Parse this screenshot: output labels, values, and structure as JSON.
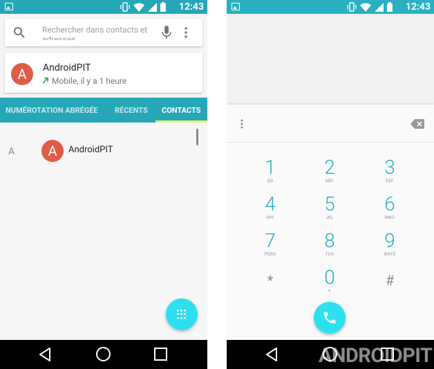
{
  "status_bar": {
    "time": "12:43",
    "icons": [
      "vibrate-icon",
      "wifi-icon",
      "signal-icon",
      "battery-icon"
    ],
    "color_left": "#26a7b8",
    "color_right": "#2ab0c0"
  },
  "search": {
    "placeholder": "Rechercher dans contacts et adresses",
    "icon": "search-icon",
    "voice_icon": "mic-icon",
    "menu_icon": "more-vert-icon"
  },
  "recent_contact": {
    "avatar_letter": "A",
    "name": "AndroidPIT",
    "detail": "Mobile, il y a 1 heure",
    "call_icon": "outgoing-call-icon",
    "avatar_color": "#e05b48"
  },
  "tabs": [
    {
      "label": "NUMÉROTATION ABRÉGÉE",
      "active": false
    },
    {
      "label": "RÉCENTS",
      "active": false
    },
    {
      "label": "CONTACTS",
      "active": true
    }
  ],
  "contacts": {
    "section_letter": "A",
    "items": [
      {
        "avatar_letter": "A",
        "name": "AndroidPIT"
      }
    ]
  },
  "fab": {
    "icon": "dialpad-icon",
    "color": "#2ee0ef"
  },
  "dialer": {
    "menu_icon": "more-vert-icon",
    "backspace_icon": "backspace-icon",
    "keys": [
      {
        "digit": "1",
        "letters": "QD"
      },
      {
        "digit": "2",
        "letters": "ABC"
      },
      {
        "digit": "3",
        "letters": "DEF"
      },
      {
        "digit": "4",
        "letters": "GHI"
      },
      {
        "digit": "5",
        "letters": "JKL"
      },
      {
        "digit": "6",
        "letters": "MNO"
      },
      {
        "digit": "7",
        "letters": "PQRS"
      },
      {
        "digit": "8",
        "letters": "TUV"
      },
      {
        "digit": "9",
        "letters": "WXYZ"
      },
      {
        "symbol": "*"
      },
      {
        "digit": "0",
        "letters": "+"
      },
      {
        "symbol": "#"
      }
    ],
    "call_icon": "phone-icon",
    "accent": "#2ab0c0"
  },
  "nav_bar": {
    "icons": [
      "back-icon",
      "home-icon",
      "recents-icon"
    ]
  },
  "watermark": "ANDROIDPIT"
}
